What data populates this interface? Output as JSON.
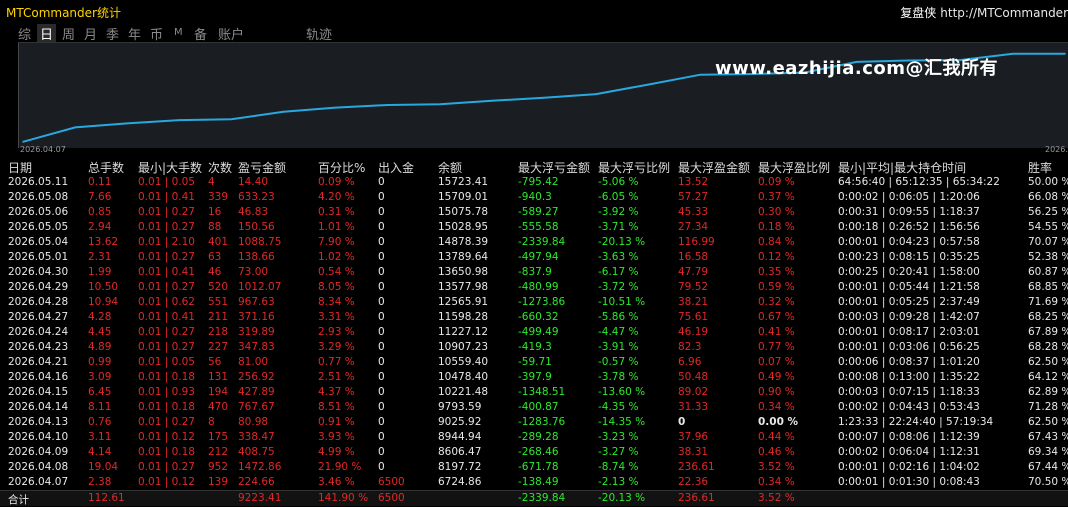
{
  "app": {
    "title": "MTCommander统计",
    "brand_cn": "复盘侠",
    "brand_url": "http://MTCommander"
  },
  "tabs": [
    {
      "label": "综",
      "active": false
    },
    {
      "label": "日",
      "active": true
    },
    {
      "label": "周",
      "active": false
    },
    {
      "label": "月",
      "active": false
    },
    {
      "label": "季",
      "active": false
    },
    {
      "label": "年",
      "active": false
    },
    {
      "label": "币",
      "active": false
    },
    {
      "label": "M",
      "active": false
    },
    {
      "label": "备",
      "active": false
    },
    {
      "label": "账户",
      "active": false
    },
    {
      "label": "轨迹",
      "active": false
    }
  ],
  "watermark": "www.eazhijia.com@汇我所有",
  "chart_data": {
    "type": "line",
    "x_labels": [
      "2026.04.07",
      "2026."
    ],
    "x": [
      "2026.04.07",
      "2026.04.08",
      "2026.04.09",
      "2026.04.10",
      "2026.04.13",
      "2026.04.14",
      "2026.04.15",
      "2026.04.16",
      "2026.04.21",
      "2026.04.23",
      "2026.04.24",
      "2026.04.27",
      "2026.04.28",
      "2026.04.29",
      "2026.04.30",
      "2026.05.01",
      "2026.05.04",
      "2026.05.05",
      "2026.05.06",
      "2026.05.08",
      "2026.05.11"
    ],
    "values": [
      6724.86,
      8197.72,
      8606.47,
      8944.94,
      9025.92,
      9793.59,
      10221.48,
      10478.4,
      10559.4,
      10907.23,
      11227.12,
      11598.28,
      12565.91,
      13577.98,
      13650.98,
      13789.64,
      14878.39,
      15028.95,
      15075.78,
      15709.01,
      15723.41
    ],
    "line_color": "#29a8e0",
    "grid": false
  },
  "table": {
    "columns": [
      "日期",
      "总手数",
      "最小|大手数",
      "次数",
      "盈亏金额",
      "百分比%",
      "出入金",
      "余额",
      "最大浮亏金额",
      "最大浮亏比例",
      "最大浮盈金额",
      "最大浮盈比例",
      "最小|平均|最大持仓时间",
      "胜率"
    ],
    "rows": [
      [
        "2026.05.11",
        "0.11",
        "0.01 | 0.05",
        "4",
        "14.40",
        "0.09 %",
        "0",
        "15723.41",
        "-795.42",
        "-5.06 %",
        "13.52",
        "0.09 %",
        "64:56:40 | 65:12:35 | 65:34:22",
        "50.00 %"
      ],
      [
        "2026.05.08",
        "7.66",
        "0.01 | 0.41",
        "339",
        "633.23",
        "4.20 %",
        "0",
        "15709.01",
        "-940.3",
        "-6.05 %",
        "57.27",
        "0.37 %",
        "0:00:02 | 0:06:05 | 1:20:06",
        "66.08 %"
      ],
      [
        "2026.05.06",
        "0.85",
        "0.01 | 0.27",
        "16",
        "46.83",
        "0.31 %",
        "0",
        "15075.78",
        "-589.27",
        "-3.92 %",
        "45.33",
        "0.30 %",
        "0:00:31 | 0:09:55 | 1:18:37",
        "56.25 %"
      ],
      [
        "2026.05.05",
        "2.94",
        "0.01 | 0.27",
        "88",
        "150.56",
        "1.01 %",
        "0",
        "15028.95",
        "-555.58",
        "-3.71 %",
        "27.34",
        "0.18 %",
        "0:00:18 | 0:26:52 | 1:56:56",
        "54.55 %"
      ],
      [
        "2026.05.04",
        "13.62",
        "0.01 | 2.10",
        "401",
        "1088.75",
        "7.90 %",
        "0",
        "14878.39",
        "-2339.84",
        "-20.13 %",
        "116.99",
        "0.84 %",
        "0:00:01 | 0:04:23 | 0:57:58",
        "70.07 %"
      ],
      [
        "2026.05.01",
        "2.31",
        "0.01 | 0.27",
        "63",
        "138.66",
        "1.02 %",
        "0",
        "13789.64",
        "-497.94",
        "-3.63 %",
        "16.58",
        "0.12 %",
        "0:00:23 | 0:08:15 | 0:35:25",
        "52.38 %"
      ],
      [
        "2026.04.30",
        "1.99",
        "0.01 | 0.41",
        "46",
        "73.00",
        "0.54 %",
        "0",
        "13650.98",
        "-837.9",
        "-6.17 %",
        "47.79",
        "0.35 %",
        "0:00:25 | 0:20:41 | 1:58:00",
        "60.87 %"
      ],
      [
        "2026.04.29",
        "10.50",
        "0.01 | 0.27",
        "520",
        "1012.07",
        "8.05 %",
        "0",
        "13577.98",
        "-480.99",
        "-3.72 %",
        "79.52",
        "0.59 %",
        "0:00:01 | 0:05:44 | 1:21:58",
        "68.85 %"
      ],
      [
        "2026.04.28",
        "10.94",
        "0.01 | 0.62",
        "551",
        "967.63",
        "8.34 %",
        "0",
        "12565.91",
        "-1273.86",
        "-10.51 %",
        "38.21",
        "0.32 %",
        "0:00:01 | 0:05:25 | 2:37:49",
        "71.69 %"
      ],
      [
        "2026.04.27",
        "4.28",
        "0.01 | 0.41",
        "211",
        "371.16",
        "3.31 %",
        "0",
        "11598.28",
        "-660.32",
        "-5.86 %",
        "75.61",
        "0.67 %",
        "0:00:03 | 0:09:28 | 1:42:07",
        "68.25 %"
      ],
      [
        "2026.04.24",
        "4.45",
        "0.01 | 0.27",
        "218",
        "319.89",
        "2.93 %",
        "0",
        "11227.12",
        "-499.49",
        "-4.47 %",
        "46.19",
        "0.41 %",
        "0:00:01 | 0:08:17 | 2:03:01",
        "67.89 %"
      ],
      [
        "2026.04.23",
        "4.89",
        "0.01 | 0.27",
        "227",
        "347.83",
        "3.29 %",
        "0",
        "10907.23",
        "-419.3",
        "-3.91 %",
        "82.3",
        "0.77 %",
        "0:00:01 | 0:03:06 | 0:56:25",
        "68.28 %"
      ],
      [
        "2026.04.21",
        "0.99",
        "0.01 | 0.05",
        "56",
        "81.00",
        "0.77 %",
        "0",
        "10559.40",
        "-59.71",
        "-0.57 %",
        "6.96",
        "0.07 %",
        "0:00:06 | 0:08:37 | 1:01:20",
        "62.50 %"
      ],
      [
        "2026.04.16",
        "3.09",
        "0.01 | 0.18",
        "131",
        "256.92",
        "2.51 %",
        "0",
        "10478.40",
        "-397.9",
        "-3.78 %",
        "50.48",
        "0.49 %",
        "0:00:08 | 0:13:00 | 1:35:22",
        "64.12 %"
      ],
      [
        "2026.04.15",
        "6.45",
        "0.01 | 0.93",
        "194",
        "427.89",
        "4.37 %",
        "0",
        "10221.48",
        "-1348.51",
        "-13.60 %",
        "89.02",
        "0.90 %",
        "0:00:03 | 0:07:15 | 1:18:33",
        "62.89 %"
      ],
      [
        "2026.04.14",
        "8.11",
        "0.01 | 0.18",
        "470",
        "767.67",
        "8.51 %",
        "0",
        "9793.59",
        "-400.87",
        "-4.35 %",
        "31.33",
        "0.34 %",
        "0:00:02 | 0:04:43 | 0:53:43",
        "71.28 %"
      ],
      [
        "2026.04.13",
        "0.76",
        "0.01 | 0.27",
        "8",
        "80.98",
        "0.91 %",
        "0",
        "9025.92",
        "-1283.76",
        "-14.35 %",
        "0",
        "0.00 %",
        "1:23:33 | 22:24:40 | 57:19:34",
        "62.50 %"
      ],
      [
        "2026.04.10",
        "3.11",
        "0.01 | 0.12",
        "175",
        "338.47",
        "3.93 %",
        "0",
        "8944.94",
        "-289.28",
        "-3.23 %",
        "37.96",
        "0.44 %",
        "0:00:07 | 0:08:06 | 1:12:39",
        "67.43 %"
      ],
      [
        "2026.04.09",
        "4.14",
        "0.01 | 0.18",
        "212",
        "408.75",
        "4.99 %",
        "0",
        "8606.47",
        "-268.46",
        "-3.27 %",
        "38.31",
        "0.46 %",
        "0:00:02 | 0:06:04 | 1:12:31",
        "69.34 %"
      ],
      [
        "2026.04.08",
        "19.04",
        "0.01 | 0.27",
        "952",
        "1472.86",
        "21.90 %",
        "0",
        "8197.72",
        "-671.78",
        "-8.74 %",
        "236.61",
        "3.52 %",
        "0:00:01 | 0:02:16 | 1:04:02",
        "67.44 %"
      ],
      [
        "2026.04.07",
        "2.38",
        "0.01 | 0.12",
        "139",
        "224.66",
        "3.46 %",
        "6500",
        "6724.86",
        "-138.49",
        "-2.13 %",
        "22.36",
        "0.34 %",
        "0:00:01 | 0:01:30 | 0:08:43",
        "70.50 %"
      ]
    ],
    "total": [
      "合计",
      "112.61",
      "",
      "",
      "9223.41",
      "141.90 %",
      "6500",
      "",
      "-2339.84",
      "-20.13 %",
      "236.61",
      "3.52 %",
      "",
      ""
    ]
  },
  "colors": {
    "profit": "#e02828",
    "loss": "#2ee82e",
    "neutral": "#e8e8e8",
    "title": "#ffd400",
    "line": "#29a8e0"
  }
}
